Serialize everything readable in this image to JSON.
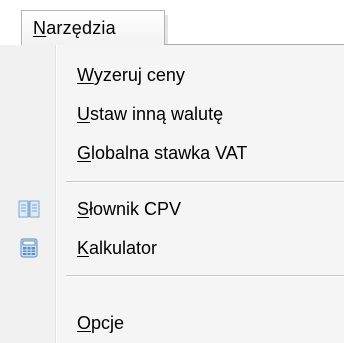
{
  "menubar": {
    "menu_title_first": "N",
    "menu_title_rest": "arzędzia"
  },
  "menu": {
    "items": [
      {
        "key": "W",
        "rest": "yzeruj ceny"
      },
      {
        "key": "U",
        "rest": "staw inną walutę"
      },
      {
        "key": "G",
        "rest": "lobalna stawka VAT"
      },
      {
        "key": "S",
        "rest": "łownik CPV",
        "icon": "book-icon"
      },
      {
        "key": "K",
        "rest": "alkulator",
        "icon": "calculator-icon"
      },
      {
        "key": "O",
        "rest": "pcje"
      }
    ]
  },
  "colors": {
    "menu_background": "#f5f5f5",
    "icon_column": "#f1f1f1",
    "separator": "#c8c8c8",
    "book_icon": "#7aa7d9",
    "calculator_icon": "#5b8fc9"
  }
}
